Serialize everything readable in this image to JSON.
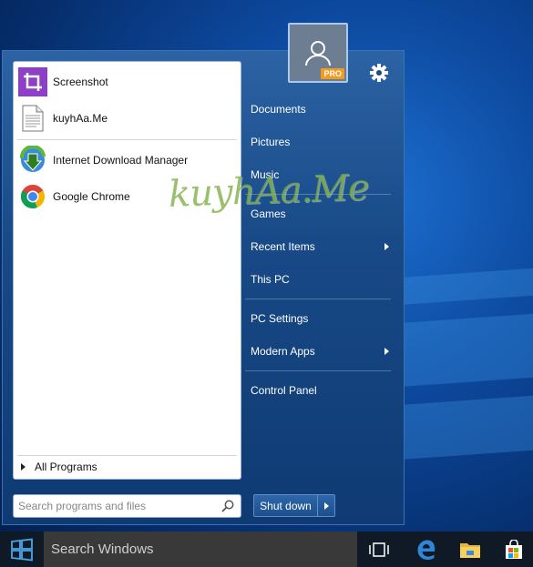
{
  "start_menu": {
    "pinned_programs": [
      {
        "label": "Screenshot",
        "icon": "screenshot-crop-icon"
      },
      {
        "label": "kuyhAa.Me",
        "icon": "text-file-icon"
      }
    ],
    "recent_programs": [
      {
        "label": "Internet Download Manager",
        "icon": "idm-icon"
      },
      {
        "label": "Google Chrome",
        "icon": "chrome-icon"
      }
    ],
    "all_programs_label": "All Programs",
    "search_placeholder": "Search programs and files",
    "shutdown_label": "Shut down",
    "user_badge": "PRO",
    "right_items": [
      {
        "label": "Documents",
        "submenu": false
      },
      {
        "label": "Pictures",
        "submenu": false
      },
      {
        "label": "Music",
        "submenu": false
      },
      {
        "label": "Games",
        "submenu": false
      },
      {
        "label": "Recent Items",
        "submenu": true
      },
      {
        "label": "This PC",
        "submenu": false
      },
      {
        "label": "PC Settings",
        "submenu": false
      },
      {
        "label": "Modern Apps",
        "submenu": true
      },
      {
        "label": "Control Panel",
        "submenu": false
      }
    ]
  },
  "watermark": {
    "text": "kuyhAa.Me"
  },
  "taskbar": {
    "search_text": "Search Windows",
    "icons": [
      "windows-start-icon",
      "task-view-icon",
      "edge-icon",
      "file-explorer-icon",
      "store-icon"
    ]
  },
  "colors": {
    "menu_bg": "#184a87",
    "accent_orange": "#f39b1e",
    "desktop_blue": "#0d4aa0",
    "taskbar_bg": "#0f1a26"
  }
}
